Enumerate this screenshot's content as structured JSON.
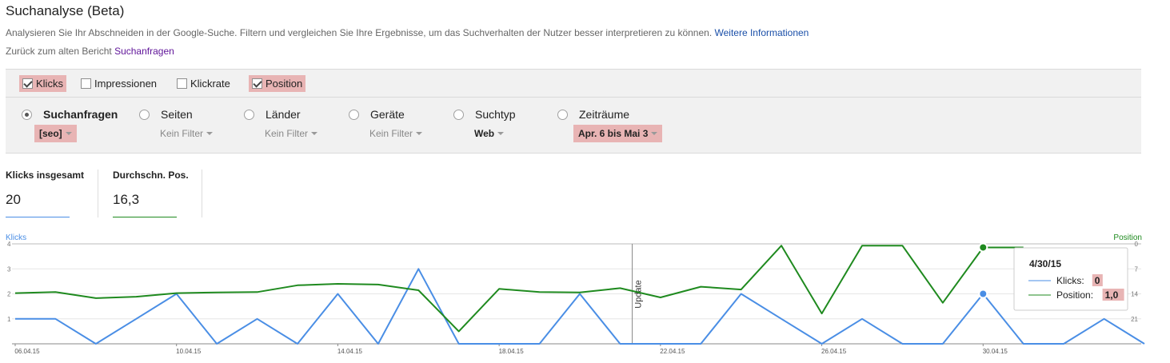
{
  "header": {
    "title": "Suchanalyse (Beta)",
    "description": "Analysieren Sie Ihr Abschneiden in der Google-Suche. Filtern und vergleichen Sie Ihre Ergebnisse, um das Suchverhalten der Nutzer besser interpretieren zu können.",
    "more_info_link": "Weitere Informationen",
    "back_prefix": "Zurück zum alten Bericht",
    "back_link": "Suchanfragen"
  },
  "metrics": [
    {
      "label": "Klicks",
      "checked": true
    },
    {
      "label": "Impressionen",
      "checked": false
    },
    {
      "label": "Klickrate",
      "checked": false
    },
    {
      "label": "Position",
      "checked": true
    }
  ],
  "dimensions": [
    {
      "label": "Suchanfragen",
      "selected": true,
      "filter": "[seo]"
    },
    {
      "label": "Seiten",
      "selected": false,
      "filter": "Kein Filter"
    },
    {
      "label": "Länder",
      "selected": false,
      "filter": "Kein Filter"
    },
    {
      "label": "Geräte",
      "selected": false,
      "filter": "Kein Filter"
    },
    {
      "label": "Suchtyp",
      "selected": false,
      "filter": "Web"
    },
    {
      "label": "Zeiträume",
      "selected": false,
      "filter": "Apr. 6 bis Mai 3"
    }
  ],
  "summary": {
    "clicks_label": "Klicks insgesamt",
    "clicks_value": "20",
    "position_label": "Durchschn. Pos.",
    "position_value": "16,3"
  },
  "colors": {
    "clicks": "#4a8ee5",
    "position": "#1f8a1f",
    "highlight": "#e8b4b4"
  },
  "chart_data": {
    "type": "line",
    "left_axis_label": "Klicks",
    "right_axis_label": "Position",
    "left_ticks": [
      "4",
      "3",
      "2",
      "1"
    ],
    "right_ticks": [
      "0",
      "7",
      "14",
      "21"
    ],
    "left_range": [
      0,
      4
    ],
    "right_range": [
      0,
      28
    ],
    "x_tick_labels": [
      "06.04.15",
      "10.04.15",
      "14.04.15",
      "18.04.15",
      "22.04.15",
      "26.04.15",
      "30.04.15"
    ],
    "x_ticks_idx": [
      0,
      4,
      8,
      12,
      16,
      20,
      24
    ],
    "annotation": {
      "label": "Update",
      "at_index": 15.3
    },
    "series": [
      {
        "name": "Klicks",
        "axis": "left",
        "values": [
          1,
          1,
          0,
          1,
          2,
          0,
          1,
          0,
          2,
          0,
          3,
          0,
          0,
          0,
          2,
          0,
          0,
          0,
          2,
          1,
          0,
          1,
          0,
          0,
          2,
          0,
          0,
          1,
          0
        ]
      },
      {
        "name": "Position",
        "axis": "right",
        "values": [
          13.8,
          13.5,
          15.2,
          14.8,
          13.8,
          13.6,
          13.5,
          11.6,
          11.2,
          11.4,
          13.0,
          24.5,
          12.6,
          13.5,
          13.6,
          12.4,
          15.0,
          12.0,
          12.8,
          0.5,
          19.5,
          0.5,
          0.5,
          16.5,
          1.0,
          1.0
        ]
      }
    ],
    "tooltip": {
      "date": "4/30/15",
      "rows": [
        {
          "label": "Klicks:",
          "value": "0",
          "series": "Klicks"
        },
        {
          "label": "Position:",
          "value": "1,0",
          "series": "Position"
        }
      ]
    }
  }
}
